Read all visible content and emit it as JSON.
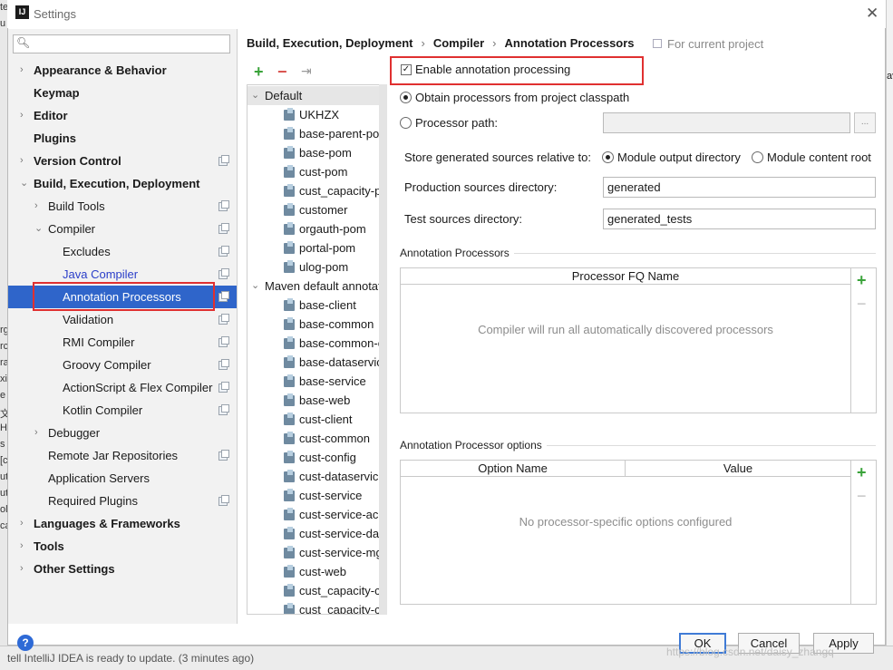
{
  "window": {
    "title": "Settings",
    "app_icon": "IJ",
    "close_symbol": "✕"
  },
  "background": {
    "status_text": "tell IntelliJ IDEA is ready to update. (3 minutes ago)",
    "left_fragments": [
      "te",
      "u",
      "rg",
      "rc",
      "ra",
      "xi",
      "e",
      "文",
      "H",
      "s",
      "[c",
      "ut",
      "ut",
      "ol",
      "ca"
    ],
    "right_fragment": "av"
  },
  "sidebar": {
    "search_placeholder": "",
    "items": [
      {
        "label": "Appearance & Behavior",
        "arrow": "›",
        "level": 0,
        "bold": true
      },
      {
        "label": "Keymap",
        "arrow": "",
        "level": 0,
        "bold": true
      },
      {
        "label": "Editor",
        "arrow": "›",
        "level": 0,
        "bold": true
      },
      {
        "label": "Plugins",
        "arrow": "",
        "level": 0,
        "bold": true
      },
      {
        "label": "Version Control",
        "arrow": "›",
        "level": 0,
        "bold": true,
        "copy": true
      },
      {
        "label": "Build, Execution, Deployment",
        "arrow": "⌄",
        "level": 0,
        "bold": true
      },
      {
        "label": "Build Tools",
        "arrow": "›",
        "level": 1,
        "copy": true
      },
      {
        "label": "Compiler",
        "arrow": "⌄",
        "level": 1,
        "copy": true
      },
      {
        "label": "Excludes",
        "arrow": "",
        "level": 2,
        "copy": true
      },
      {
        "label": "Java Compiler",
        "arrow": "",
        "level": 2,
        "copy": true,
        "link": true
      },
      {
        "label": "Annotation Processors",
        "arrow": "",
        "level": 2,
        "copy": true,
        "selected": true
      },
      {
        "label": "Validation",
        "arrow": "",
        "level": 2,
        "copy": true
      },
      {
        "label": "RMI Compiler",
        "arrow": "",
        "level": 2,
        "copy": true
      },
      {
        "label": "Groovy Compiler",
        "arrow": "",
        "level": 2,
        "copy": true
      },
      {
        "label": "ActionScript & Flex Compiler",
        "arrow": "",
        "level": 2,
        "copy": true
      },
      {
        "label": "Kotlin Compiler",
        "arrow": "",
        "level": 2,
        "copy": true
      },
      {
        "label": "Debugger",
        "arrow": "›",
        "level": 1
      },
      {
        "label": "Remote Jar Repositories",
        "arrow": "",
        "level": 1,
        "copy": true
      },
      {
        "label": "Application Servers",
        "arrow": "",
        "level": 1
      },
      {
        "label": "Required Plugins",
        "arrow": "",
        "level": 1,
        "copy": true
      },
      {
        "label": "Languages & Frameworks",
        "arrow": "›",
        "level": 0,
        "bold": true
      },
      {
        "label": "Tools",
        "arrow": "›",
        "level": 0,
        "bold": true
      },
      {
        "label": "Other Settings",
        "arrow": "›",
        "level": 0,
        "bold": true
      }
    ]
  },
  "breadcrumb": {
    "parts": [
      "Build, Execution, Deployment",
      "Compiler",
      "Annotation Processors"
    ],
    "separator": "›",
    "for_project": "For current project"
  },
  "profiles": {
    "toolbar": {
      "add": "+",
      "remove": "−",
      "move": "⇥"
    },
    "groups": [
      {
        "label": "Default",
        "modules": [
          "UKHZX",
          "base-parent-pom",
          "base-pom",
          "cust-pom",
          "cust_capacity-pom",
          "customer",
          "orgauth-pom",
          "portal-pom",
          "ulog-pom"
        ]
      },
      {
        "label": "Maven default annotation processors",
        "modules": [
          "base-client",
          "base-common",
          "base-common-client",
          "base-dataservice",
          "base-service",
          "base-web",
          "cust-client",
          "cust-common",
          "cust-config",
          "cust-dataservice",
          "cust-service",
          "cust-service-acct",
          "cust-service-data",
          "cust-service-mgmt",
          "cust-web",
          "cust_capacity-client",
          "cust_capacity-core"
        ]
      }
    ]
  },
  "settings": {
    "enable_label": "Enable annotation processing",
    "enable_checked": true,
    "obtain_label": "Obtain processors from project classpath",
    "path_label": "Processor path:",
    "path_value": "",
    "browse_label": "...",
    "store_label": "Store generated sources relative to:",
    "module_output_label": "Module output directory",
    "module_content_label": "Module content root",
    "prod_label": "Production sources directory:",
    "prod_value": "generated",
    "test_label": "Test sources directory:",
    "test_value": "generated_tests"
  },
  "processors_section": {
    "title": "Annotation Processors",
    "column": "Processor FQ Name",
    "empty_text": "Compiler will run all automatically discovered processors",
    "add": "+",
    "remove": "−"
  },
  "options_section": {
    "title": "Annotation Processor options",
    "columns": [
      "Option Name",
      "Value"
    ],
    "empty_text": "No processor-specific options configured",
    "add": "+",
    "remove": "−"
  },
  "footer": {
    "help": "?",
    "ok": "OK",
    "cancel": "Cancel",
    "apply": "Apply",
    "watermark": "https://blog.csdn.net/daisy_zhangq"
  }
}
